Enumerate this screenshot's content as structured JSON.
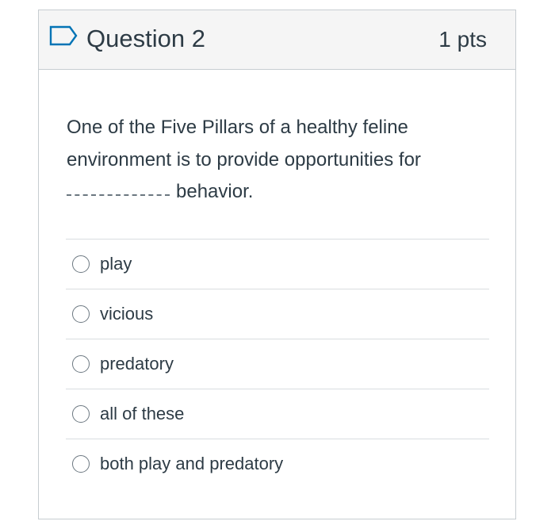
{
  "question": {
    "title": "Question 2",
    "points": "1 pts",
    "text_line1": "One of the Five Pillars of a healthy feline environment is to provide opportunities for",
    "text_after_blank": "behavior.",
    "flag_icon": "flag-outline-icon"
  },
  "answers": [
    {
      "label": "play",
      "selected": false
    },
    {
      "label": "vicious",
      "selected": false
    },
    {
      "label": "predatory",
      "selected": false
    },
    {
      "label": "all of these",
      "selected": false
    },
    {
      "label": "both play and predatory",
      "selected": false
    }
  ],
  "colors": {
    "text": "#2d3b45",
    "header_bg": "#f5f5f5",
    "border": "#c7cdd1",
    "flag": "#0374b5",
    "radio_border": "#6b7780"
  }
}
